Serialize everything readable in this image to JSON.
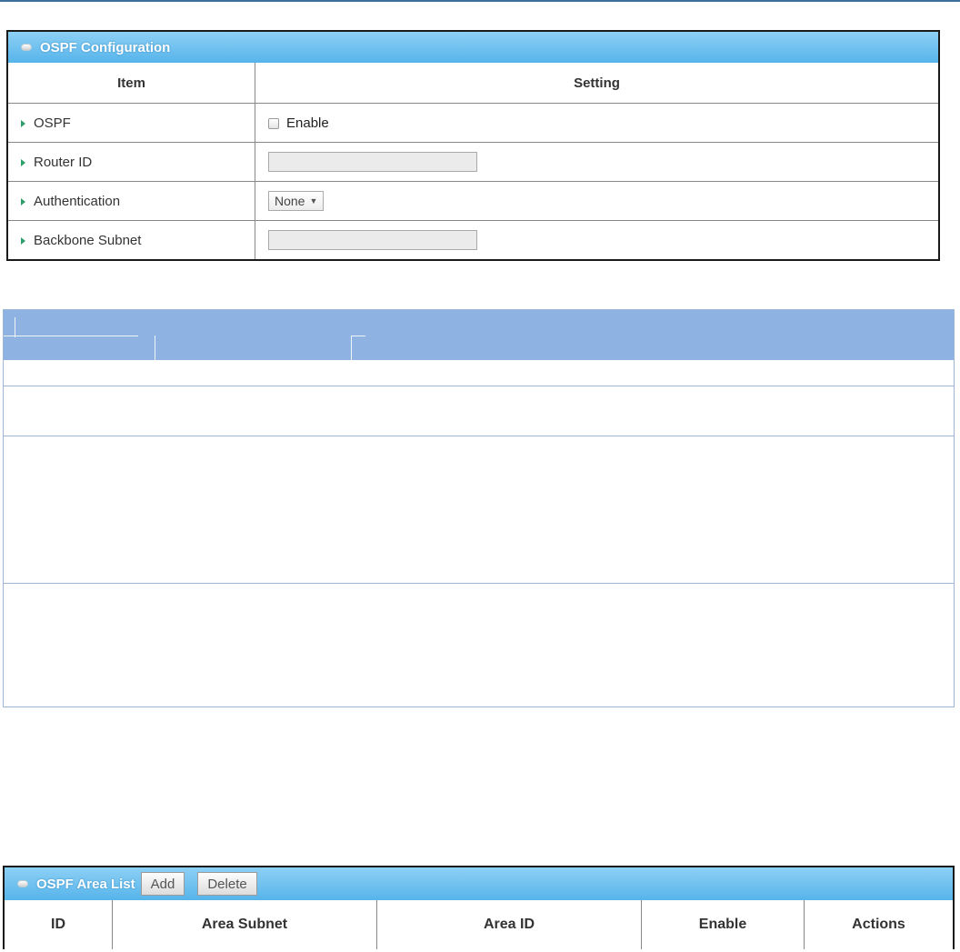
{
  "config": {
    "title": "OSPF Configuration",
    "columns": {
      "item": "Item",
      "setting": "Setting"
    },
    "rows": {
      "ospf": {
        "label": "OSPF",
        "checkbox_label": "Enable",
        "checked": false
      },
      "router_id": {
        "label": "Router ID",
        "value": ""
      },
      "authentication": {
        "label": "Authentication",
        "selected": "None"
      },
      "backbone_subnet": {
        "label": "Backbone Subnet",
        "value": ""
      }
    }
  },
  "area_list": {
    "title": "OSPF Area List",
    "buttons": {
      "add": "Add",
      "delete": "Delete"
    },
    "columns": [
      "ID",
      "Area Subnet",
      "Area ID",
      "Enable",
      "Actions"
    ]
  },
  "colors": {
    "panel_header": "#56b4ea",
    "desc_header": "#8eb3e3",
    "row_marker": "#2e9e6a"
  }
}
